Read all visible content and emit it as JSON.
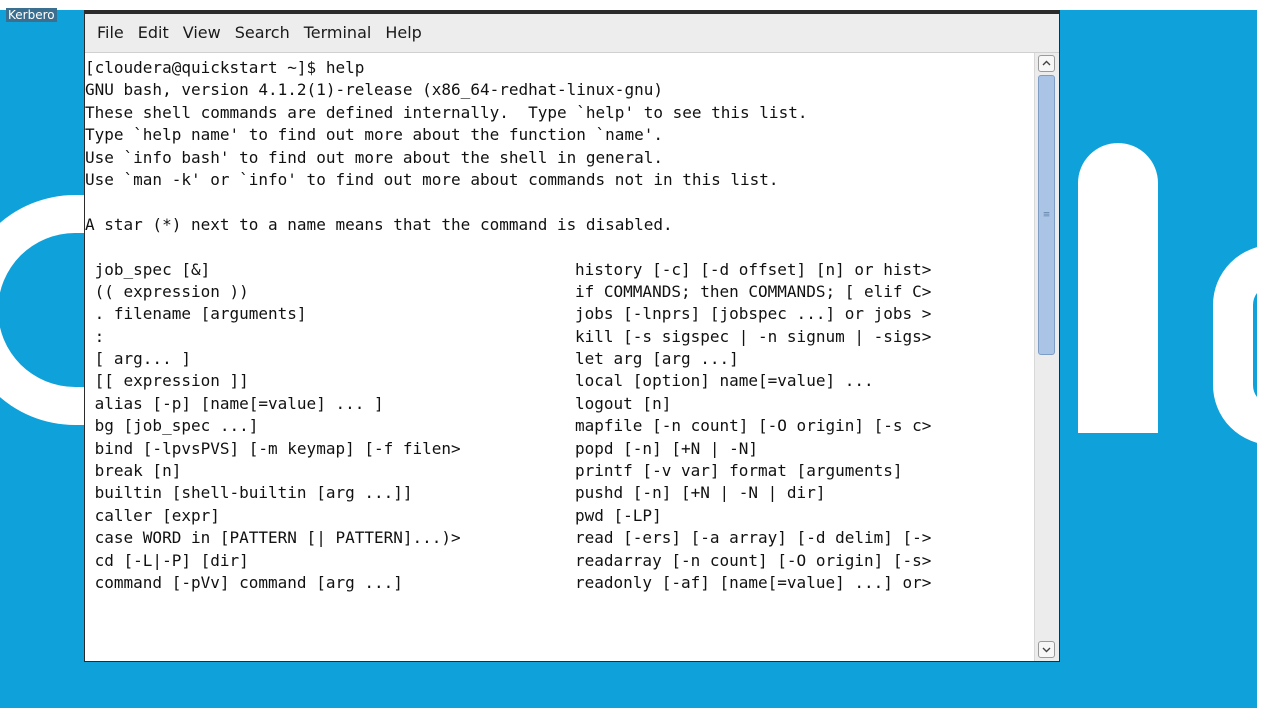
{
  "desktop": {
    "label": "Kerbero",
    "background_color": "#0ea1da"
  },
  "terminal": {
    "menu": [
      "File",
      "Edit",
      "View",
      "Search",
      "Terminal",
      "Help"
    ],
    "lines": [
      "[cloudera@quickstart ~]$ help",
      "GNU bash, version 4.1.2(1)-release (x86_64-redhat-linux-gnu)",
      "These shell commands are defined internally.  Type `help' to see this list.",
      "Type `help name' to find out more about the function `name'.",
      "Use `info bash' to find out more about the shell in general.",
      "Use `man -k' or `info' to find out more about commands not in this list.",
      "",
      "A star (*) next to a name means that the command is disabled.",
      ""
    ],
    "commands_left": [
      " job_spec [&]",
      " (( expression ))",
      " . filename [arguments]",
      " :",
      " [ arg... ]",
      " [[ expression ]]",
      " alias [-p] [name[=value] ... ]",
      " bg [job_spec ...]",
      " bind [-lpvsPVS] [-m keymap] [-f filen>",
      " break [n]",
      " builtin [shell-builtin [arg ...]]",
      " caller [expr]",
      " case WORD in [PATTERN [| PATTERN]...)>",
      " cd [-L|-P] [dir]",
      " command [-pVv] command [arg ...]"
    ],
    "commands_right": [
      "history [-c] [-d offset] [n] or hist>",
      "if COMMANDS; then COMMANDS; [ elif C>",
      "jobs [-lnprs] [jobspec ...] or jobs >",
      "kill [-s sigspec | -n signum | -sigs>",
      "let arg [arg ...]",
      "local [option] name[=value] ...",
      "logout [n]",
      "mapfile [-n count] [-O origin] [-s c>",
      "popd [-n] [+N | -N]",
      "printf [-v var] format [arguments]",
      "pushd [-n] [+N | -N | dir]",
      "pwd [-LP]",
      "read [-ers] [-a array] [-d delim] [->",
      "readarray [-n count] [-O origin] [-s>",
      "readonly [-af] [name[=value] ...] or>"
    ]
  },
  "scrollbar": {
    "up_icon": "chevron-up-icon",
    "down_icon": "chevron-down-icon",
    "grip": "≡"
  }
}
